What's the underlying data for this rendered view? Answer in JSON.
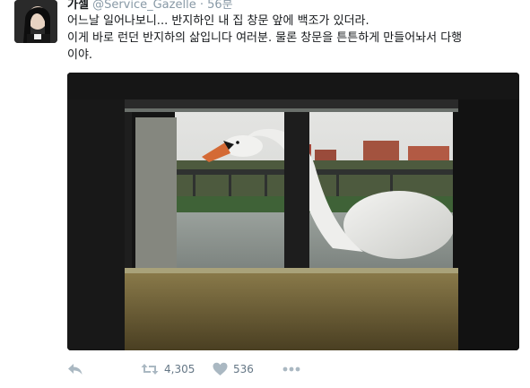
{
  "tweet": {
    "display_name": "가젤",
    "handle": "@Service_Gazelle",
    "separator": "·",
    "time": "56분",
    "text": "어느날 일어나보니... 반지하인 내 집 창문 앞에 백조가 있더라.\n이게 바로 런던 반지하의 삶입니다 여러분. 물론 창문을 튼튼하게 만들어놔서 다행\n이야."
  },
  "actions": {
    "reply_icon": "reply-icon",
    "retweet_icon": "retweet-icon",
    "retweet_count": "4,305",
    "like_icon": "heart-icon",
    "like_count": "536",
    "more_icon": "more-icon"
  },
  "colors": {
    "text": "#14171a",
    "secondary": "#8899a6",
    "action": "#aab8c2"
  }
}
